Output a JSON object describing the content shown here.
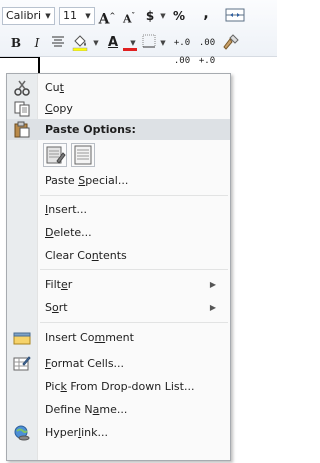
{
  "toolbar": {
    "font_name": "Calibri",
    "font_size": "11",
    "grow_font": "A",
    "shrink_font": "A",
    "currency": "$",
    "percent": "%",
    "comma": ",",
    "bold": "B",
    "italic": "I",
    "font_color_letter": "A",
    "increase_decimal": "+.0 .00",
    "decrease_decimal": ".00 +.0"
  },
  "menu": {
    "cut": "Cut",
    "copy": "Copy",
    "paste_options": "Paste Options:",
    "paste_special": "Paste Special...",
    "insert": "Insert...",
    "delete": "Delete...",
    "clear_contents": "Clear Contents",
    "filter": "Filter",
    "sort": "Sort",
    "insert_comment": "Insert Comment",
    "format_cells": "Format Cells...",
    "pick_from_list": "Pick From Drop-down List...",
    "define_name": "Define Name...",
    "hyperlink": "Hyperlink..."
  }
}
